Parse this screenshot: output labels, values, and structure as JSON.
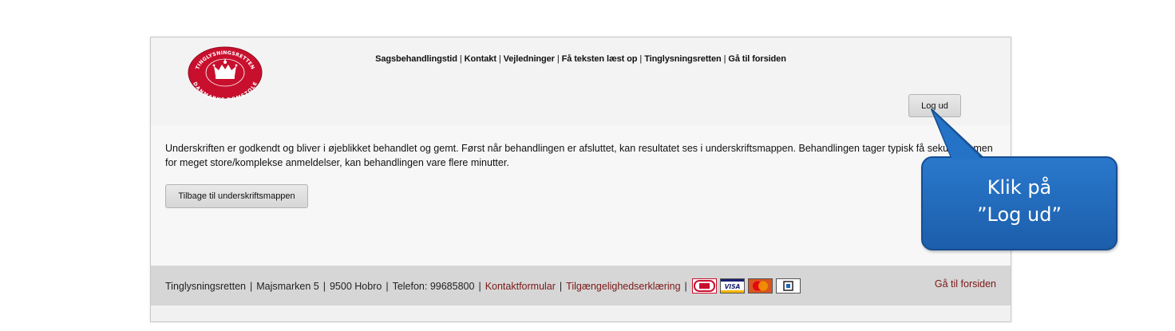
{
  "header": {
    "logo": {
      "top_text": "TINGLYSNINGSRETTEN",
      "bottom_text": "DANMARKS DOMSTOLE",
      "color": "#c8102e"
    },
    "nav": [
      {
        "label": "Sagsbehandlingstid"
      },
      {
        "label": "Kontakt"
      },
      {
        "label": "Vejledninger"
      },
      {
        "label": "Få teksten læst op"
      },
      {
        "label": "Tinglysningsretten"
      },
      {
        "label": "Gå til forsiden"
      }
    ],
    "nav_separator": "|",
    "logout_label": "Log ud"
  },
  "main": {
    "message": "Underskriften er godkendt og bliver i øjeblikket behandlet og gemt. Først når behandlingen er afsluttet, kan resultatet ses i underskriftsmappen. Behandlingen tager typisk få sekunder, men for meget store/komplekse anmeldelser, kan behandlingen vare flere minutter.",
    "back_button_label": "Tilbage til underskriftsmappen"
  },
  "footer": {
    "items": [
      {
        "text": "Tinglysningsretten",
        "link": false
      },
      {
        "text": "Majsmarken 5",
        "link": false
      },
      {
        "text": "9500 Hobro",
        "link": false
      },
      {
        "text": "Telefon: 99685800",
        "link": false
      },
      {
        "text": "Kontaktformular",
        "link": true
      },
      {
        "text": "Tilgængelighedserklæring",
        "link": true
      }
    ],
    "separator": "|",
    "cards": [
      "dankort-icon",
      "visa-icon",
      "mastercard-icon",
      "maestro-icon"
    ],
    "visa_text": "VISA",
    "right_link": "Gå til forsiden",
    "link_color": "#7a1818"
  },
  "callout": {
    "line1": "Klik på",
    "line2": "”Log ud”",
    "color": "#1f64b4"
  }
}
